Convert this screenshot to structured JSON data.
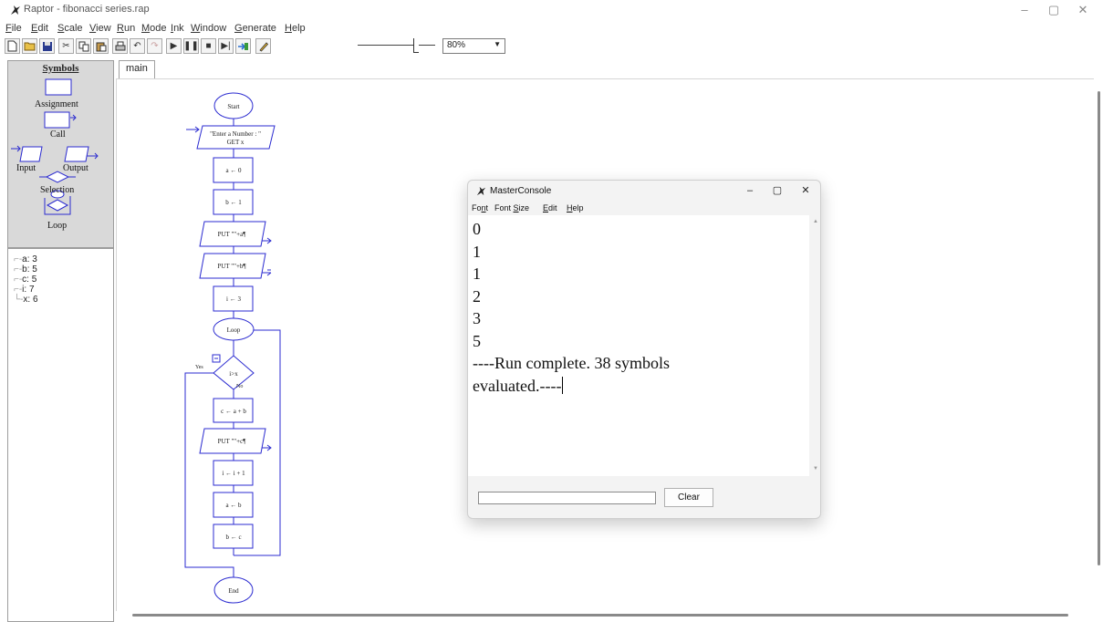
{
  "window": {
    "title": "Raptor - fibonacci series.rap",
    "controls": {
      "minimize": "–",
      "maximize": "▢",
      "close": "✕"
    }
  },
  "menu": [
    {
      "label": "File",
      "accel": "F"
    },
    {
      "label": "Edit",
      "accel": "E"
    },
    {
      "label": "Scale",
      "accel": "S"
    },
    {
      "label": "View",
      "accel": "V"
    },
    {
      "label": "Run",
      "accel": "R"
    },
    {
      "label": "Mode",
      "accel": "M"
    },
    {
      "label": "Ink",
      "accel": "I"
    },
    {
      "label": "Window",
      "accel": "W"
    },
    {
      "label": "Generate",
      "accel": "G"
    },
    {
      "label": "Help",
      "accel": "H"
    }
  ],
  "toolbar": {
    "icons": [
      "new-file-icon",
      "open-folder-icon",
      "save-icon",
      "cut-icon",
      "copy-icon",
      "paste-icon",
      "print-icon",
      "undo-icon",
      "redo-icon",
      "play-icon",
      "pause-icon",
      "stop-icon",
      "step-icon",
      "step-into-icon",
      "pencil-icon"
    ],
    "zoom": "80%"
  },
  "symbols_panel": {
    "heading": "Symbols",
    "items": [
      "Assignment",
      "Call",
      "Input",
      "Output",
      "Selection",
      "Loop"
    ]
  },
  "variables": [
    {
      "text": "a: 3"
    },
    {
      "text": "b: 5"
    },
    {
      "text": "c: 5"
    },
    {
      "text": "i: 7"
    },
    {
      "text": "x: 6"
    }
  ],
  "tabs": [
    {
      "label": "main"
    }
  ],
  "flowchart": {
    "start": "Start",
    "input_prompt": "\"Enter a Number : \"",
    "input_get": "GET x",
    "assign_a": "a ← 0",
    "assign_b": "b ← 1",
    "output_a": "PUT \"\"+a¶",
    "output_b": "PUT \"\"+b¶",
    "assign_i": "i ← 3",
    "loop": "Loop",
    "condition": "i>x",
    "yes": "Yes",
    "no": "No",
    "assign_c": "c ← a + b",
    "output_c": "PUT \"\"+c¶",
    "increment_i": "i ← i + 1",
    "shift_a": "a ← b",
    "shift_b": "b ← c",
    "end": "End"
  },
  "console": {
    "title": "MasterConsole",
    "menu": [
      {
        "label": "Font",
        "accel": "n"
      },
      {
        "label": "Font Size",
        "accel": "S"
      },
      {
        "label": "Edit",
        "accel": "E"
      },
      {
        "label": "Help",
        "accel": "H"
      }
    ],
    "output_lines": [
      "0",
      "1",
      "1",
      "2",
      "3",
      "5",
      "----Run complete.  38 symbols",
      "evaluated.----"
    ],
    "input_value": "",
    "clear_label": "Clear"
  }
}
